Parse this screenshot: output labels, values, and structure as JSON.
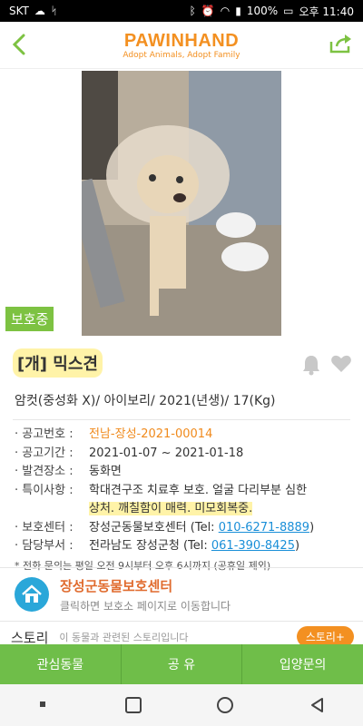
{
  "status_bar": {
    "carrier": "SKT",
    "battery": "100%",
    "time": "오후 11:40"
  },
  "header": {
    "brand": "PAWINHAND",
    "tagline": "Adopt Animals, Adopt Family"
  },
  "photo": {
    "status_tag": "보호중"
  },
  "animal": {
    "name": "[개] 믹스견",
    "summary": "암컷(중성화 X)/ 아이보리/ 2021(년생)/ 17(Kg)"
  },
  "details": {
    "notice_no_label": "· 공고번호 :",
    "notice_no": "전남-장성-2021-00014",
    "period_label": "· 공고기간 :",
    "period": "2021-01-07 ~ 2021-01-18",
    "found_label": "· 발견장소 :",
    "found": "동화면",
    "features_label": "· 특이사항 :",
    "features_line1": "학대견구조 치료후 보호. 얼굴 다리부분 심한",
    "features_line2": "상처. 깨칠함이 매력. 미모회복중.",
    "center_label": "· 보호센터 :",
    "center_name": "장성군동물보호센터 (Tel: ",
    "center_tel": "010-6271-8889",
    "center_close": ")",
    "dept_label": "· 담당부서 :",
    "dept_name": "전라남도 장성군청 (Tel: ",
    "dept_tel": "061-390-8425",
    "dept_close": ")",
    "note": "* 전화 문의는 평일 오전 9시부터 오후 6시까지 (공휴일 제외)"
  },
  "shelter_card": {
    "name": "장성군동물보호센터",
    "sub": "클릭하면 보호소 페이지로 이동합니다"
  },
  "story": {
    "title": "스토리",
    "desc": "이 동물과 관련된 스토리입니다",
    "button": "스토리+"
  },
  "bottom_bar": {
    "interest": "관심동물",
    "share": "공 유",
    "adopt": "입양문의"
  },
  "colors": {
    "brand_orange": "#f39021",
    "green": "#7dc242",
    "link_blue": "#1a8fd8"
  }
}
